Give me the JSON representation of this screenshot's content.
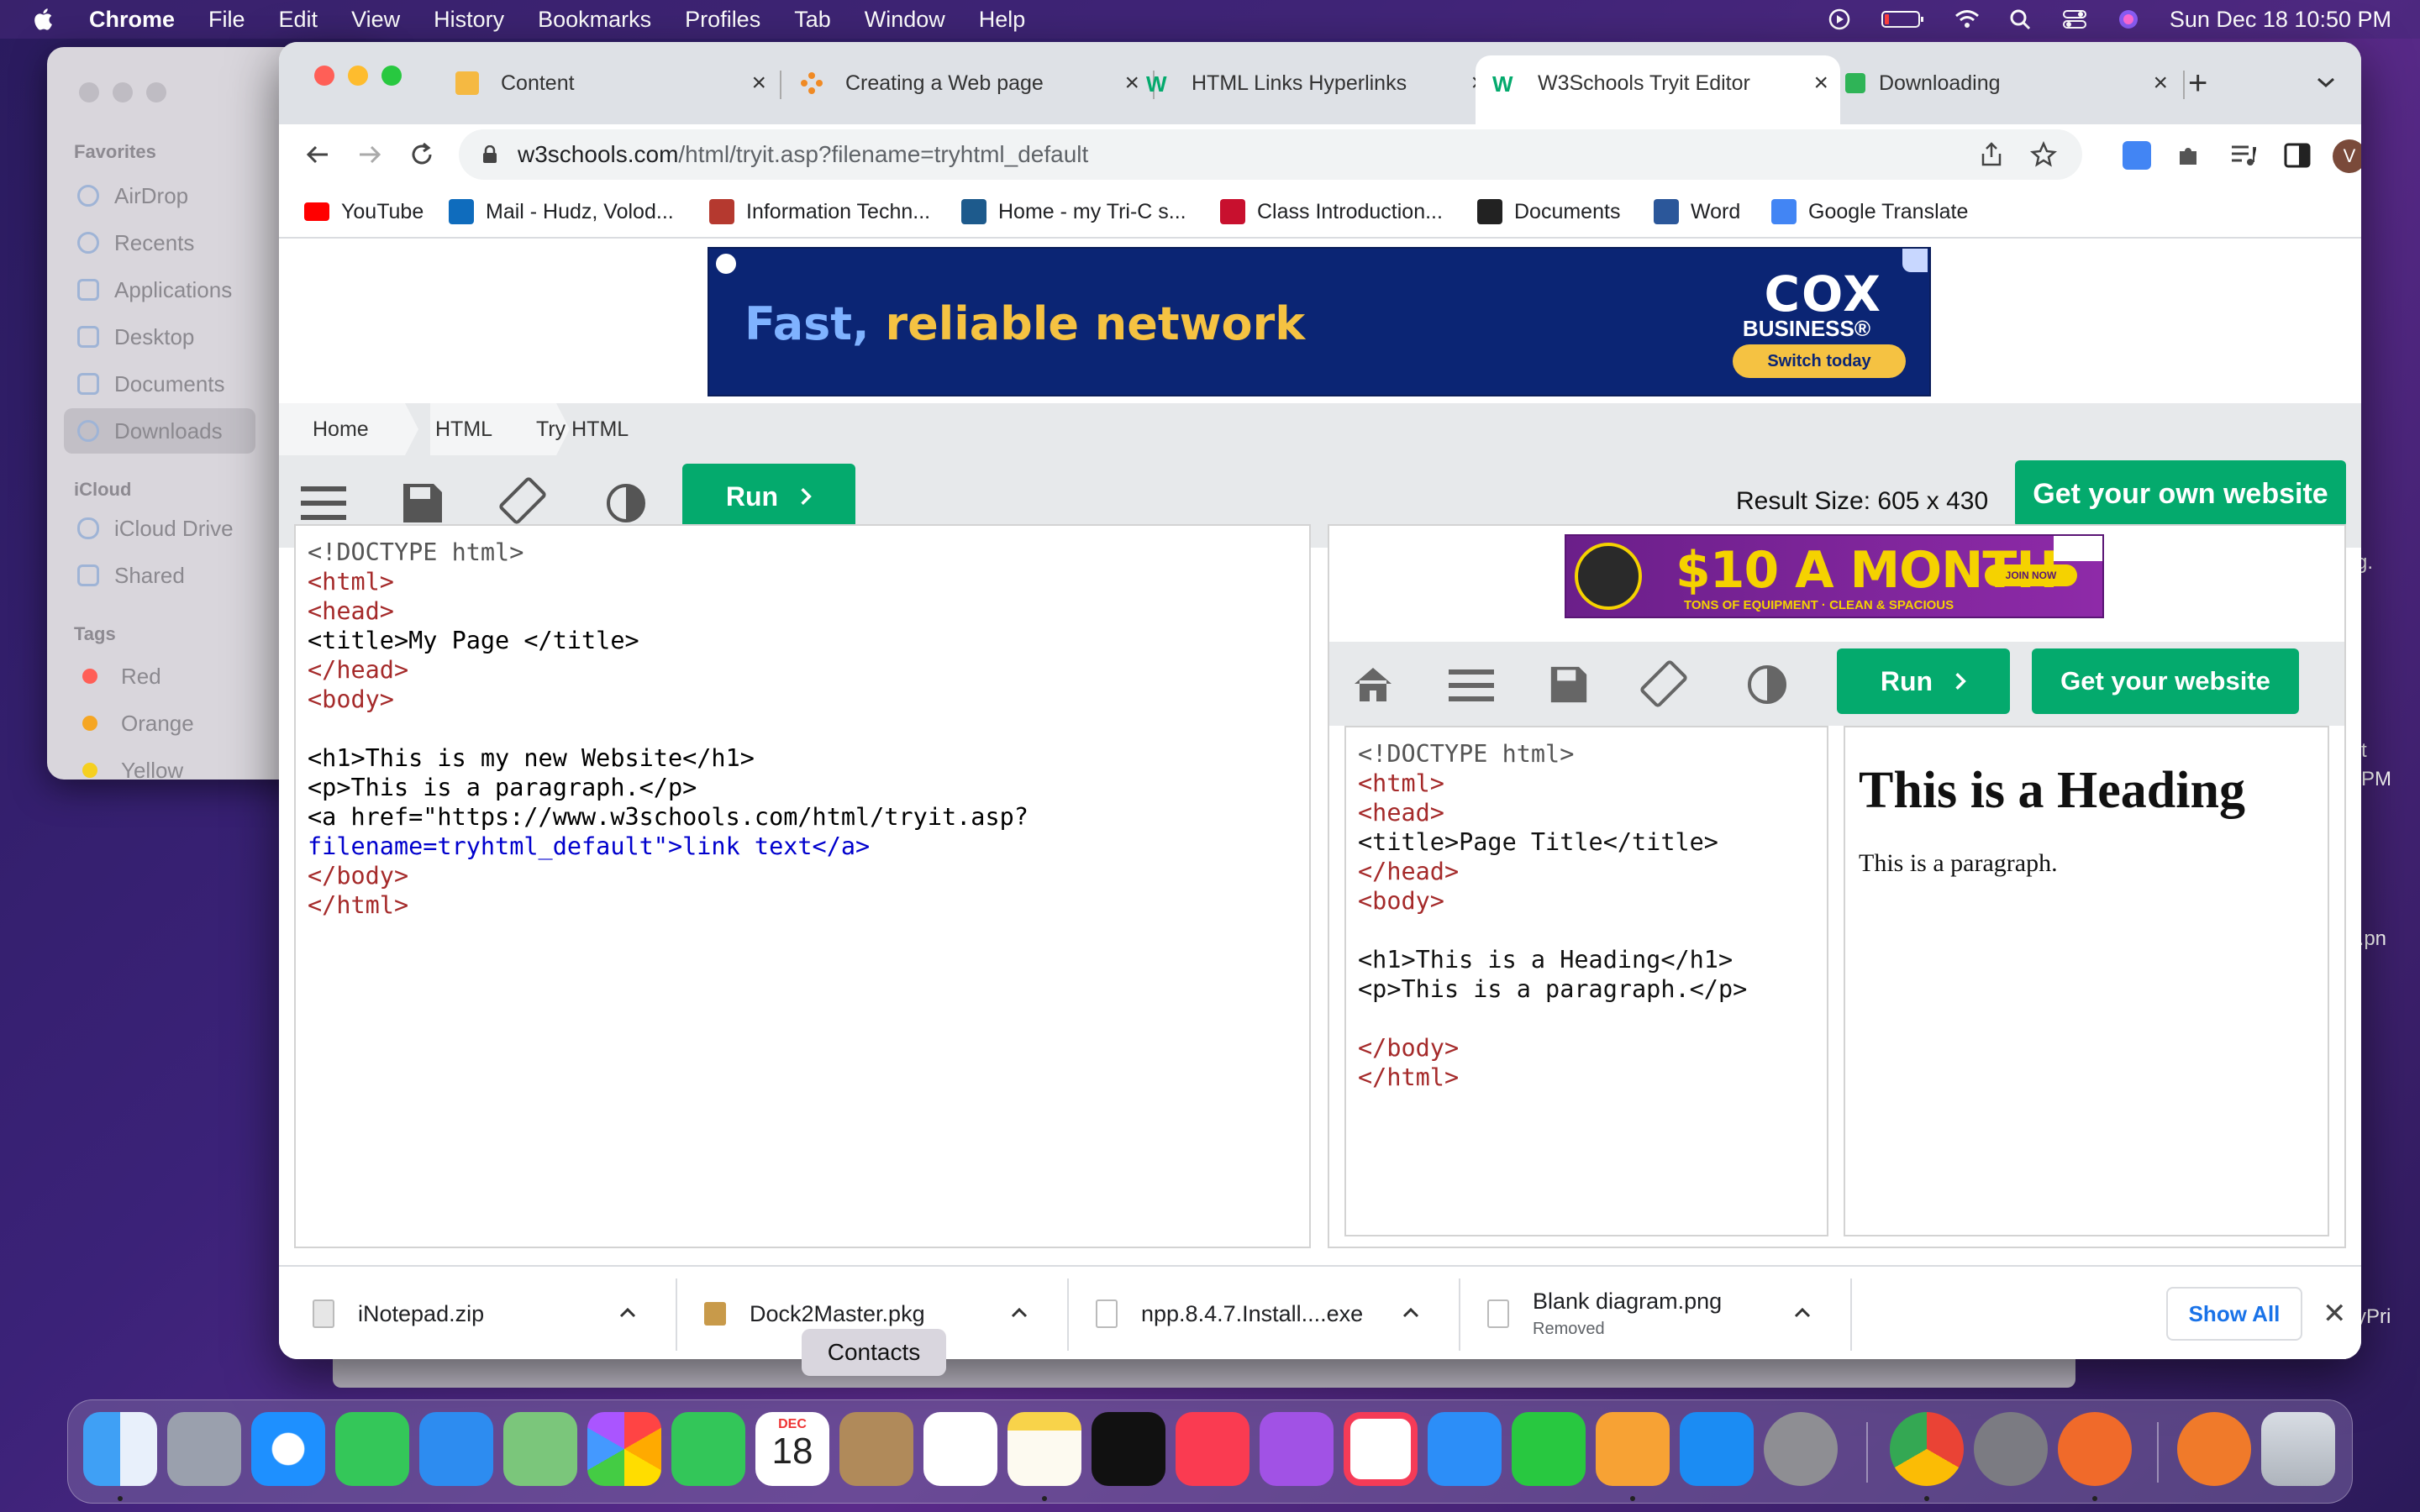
{
  "menubar": {
    "app": "Chrome",
    "items": [
      "File",
      "Edit",
      "View",
      "History",
      "Bookmarks",
      "Profiles",
      "Tab",
      "Window",
      "Help"
    ],
    "datetime": "Sun Dec 18  10:50 PM"
  },
  "finder": {
    "favorites_label": "Favorites",
    "favorites": [
      "AirDrop",
      "Recents",
      "Applications",
      "Desktop",
      "Documents",
      "Downloads"
    ],
    "selected": "Downloads",
    "icloud_label": "iCloud",
    "icloud": [
      "iCloud Drive",
      "Shared"
    ],
    "tags_label": "Tags",
    "tags": [
      {
        "label": "Red",
        "color": "#ff5f57"
      },
      {
        "label": "Orange",
        "color": "#f5a623"
      },
      {
        "label": "Yellow",
        "color": "#f5d020"
      }
    ]
  },
  "tabs": [
    {
      "title": "Content",
      "icon": "pencil-doc-icon"
    },
    {
      "title": "Creating a Web page",
      "icon": "dots-icon"
    },
    {
      "title": "HTML Links Hyperlinks",
      "icon": "w3schools-icon"
    },
    {
      "title": "W3Schools Tryit Editor",
      "icon": "w3schools-icon",
      "active": true
    },
    {
      "title": "Downloading",
      "icon": "checkbox-icon"
    }
  ],
  "address_bar": {
    "host": "w3schools.com",
    "path": "/html/tryit.asp?filename=tryhtml_default",
    "profile_initial": "V"
  },
  "bookmarks": [
    "YouTube",
    "Mail - Hudz, Volod...",
    "Information Techn...",
    "Home - my Tri-C s...",
    "Class Introduction...",
    "Documents",
    "Word",
    "Google Translate"
  ],
  "top_ad": {
    "headline_1": "Fast,",
    "headline_2": "reliable network",
    "brand": "COX",
    "brand_sub": "BUSINESS®",
    "cta": "Switch today"
  },
  "breadcrumb": [
    "Home",
    "HTML",
    "Try HTML"
  ],
  "tryit": {
    "run_label": "Run",
    "result_size": "Result Size: 605 x 430",
    "own_site_label": "Get your own website"
  },
  "editor_lines": [
    "<!DOCTYPE html>",
    "<html>",
    "<head>",
    "<title>My Page </title>",
    "</head>",
    "<body>",
    "",
    "<h1>This is my new Website</h1>",
    "<p>This is a paragraph.</p>",
    "<a href=\"https://www.w3schools.com/html/tryit.asp?",
    "filename=tryhtml_default\">link text</a>",
    "</body>",
    "</html>"
  ],
  "result_ad": {
    "headline": "$10 A MONTH",
    "sub": "TONS OF EQUIPMENT · CLEAN & SPACIOUS",
    "cta": "JOIN NOW"
  },
  "inner": {
    "run_label": "Run",
    "own_site_label": "Get your website",
    "editor_lines": [
      "<!DOCTYPE html>",
      "<html>",
      "<head>",
      "<title>Page Title</title>",
      "</head>",
      "<body>",
      "",
      "<h1>This is a Heading</h1>",
      "<p>This is a paragraph.</p>",
      "",
      "</body>",
      "</html>"
    ],
    "result_heading": "This is a Heading",
    "result_paragraph": "This is a paragraph."
  },
  "downloads": [
    {
      "name": "iNotepad.zip",
      "status": ""
    },
    {
      "name": "Dock2Master.pkg",
      "status": ""
    },
    {
      "name": "npp.8.4.7.Install....exe",
      "status": ""
    },
    {
      "name": "Blank diagram.png",
      "status": "Removed"
    }
  ],
  "downloads_show_all": "Show All",
  "dock_tooltip": "Contacts",
  "dock_calendar": {
    "month": "DEC",
    "day": "18"
  },
  "edge_text": [
    "g.",
    "t",
    "PM",
    "r.pn",
    "yPri"
  ],
  "colors": {
    "accent_green": "#04aa6d",
    "tag_blue": "#0000cd",
    "tag_name": "#a52a2a",
    "attr_name": "#ff0000"
  }
}
